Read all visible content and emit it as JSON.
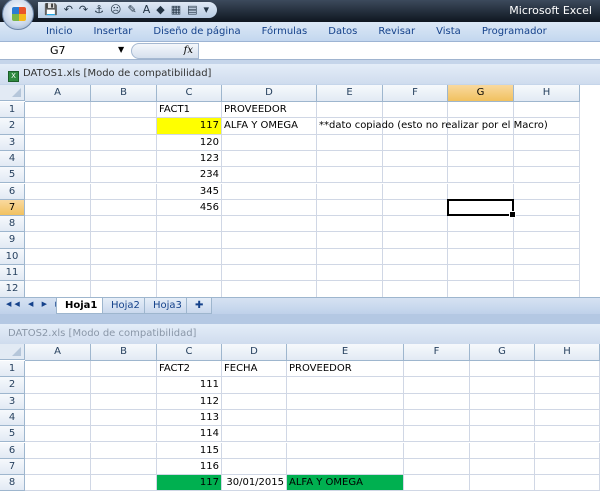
{
  "app_title": "Microsoft Excel",
  "quick_access": [
    "save-icon",
    "undo-icon",
    "redo-icon",
    "anchor-icon",
    "sad-face-icon",
    "format-painter-icon",
    "font-size-icon",
    "fill-color-icon",
    "table-icon",
    "form-icon",
    "customize-icon"
  ],
  "ribbon_tabs": [
    "Inicio",
    "Insertar",
    "Diseño de página",
    "Fórmulas",
    "Datos",
    "Revisar",
    "Vista",
    "Programador"
  ],
  "formula_bar": {
    "name_box": "G7",
    "fx": "fx",
    "formula": ""
  },
  "colors": {
    "yellow": "#ffff00",
    "green": "#00b050"
  },
  "workbook1": {
    "title": "DATOS1.xls  [Modo de compatibilidad]",
    "columns": [
      "A",
      "B",
      "C",
      "D",
      "E",
      "F",
      "G",
      "H"
    ],
    "rows": [
      "1",
      "2",
      "3",
      "4",
      "5",
      "6",
      "7",
      "8",
      "9",
      "10",
      "11",
      "12"
    ],
    "selected_cell": "G7",
    "cells": [
      {
        "ref": "C1",
        "value": "FACT1"
      },
      {
        "ref": "D1",
        "value": "PROVEEDOR"
      },
      {
        "ref": "C2",
        "value": "117",
        "num": true,
        "fill": "#ffff00"
      },
      {
        "ref": "D2",
        "value": "ALFA Y OMEGA"
      },
      {
        "ref": "E2",
        "value": "**dato copiado (esto no realizar por el Macro)"
      },
      {
        "ref": "C3",
        "value": "120",
        "num": true
      },
      {
        "ref": "C4",
        "value": "123",
        "num": true
      },
      {
        "ref": "C5",
        "value": "234",
        "num": true
      },
      {
        "ref": "C6",
        "value": "345",
        "num": true
      },
      {
        "ref": "C7",
        "value": "456",
        "num": true
      }
    ],
    "sheet_tabs": [
      "Hoja1",
      "Hoja2",
      "Hoja3"
    ],
    "active_sheet": "Hoja1"
  },
  "workbook2": {
    "title": "DATOS2.xls  [Modo de compatibilidad]",
    "columns": [
      "A",
      "B",
      "C",
      "D",
      "E",
      "F",
      "G",
      "H"
    ],
    "rows": [
      "1",
      "2",
      "3",
      "4",
      "5",
      "6",
      "7",
      "8"
    ],
    "cells": [
      {
        "ref": "C1",
        "value": "FACT2"
      },
      {
        "ref": "D1",
        "value": "FECHA"
      },
      {
        "ref": "E1",
        "value": "PROVEEDOR"
      },
      {
        "ref": "C2",
        "value": "111",
        "num": true
      },
      {
        "ref": "C3",
        "value": "112",
        "num": true
      },
      {
        "ref": "C4",
        "value": "113",
        "num": true
      },
      {
        "ref": "C5",
        "value": "114",
        "num": true
      },
      {
        "ref": "C6",
        "value": "115",
        "num": true
      },
      {
        "ref": "C7",
        "value": "116",
        "num": true
      },
      {
        "ref": "C8",
        "value": "117",
        "num": true,
        "fill": "#00b050"
      },
      {
        "ref": "D8",
        "value": "30/01/2015",
        "num": true
      },
      {
        "ref": "E8",
        "value": "ALFA Y OMEGA",
        "fill": "#00b050"
      }
    ]
  }
}
